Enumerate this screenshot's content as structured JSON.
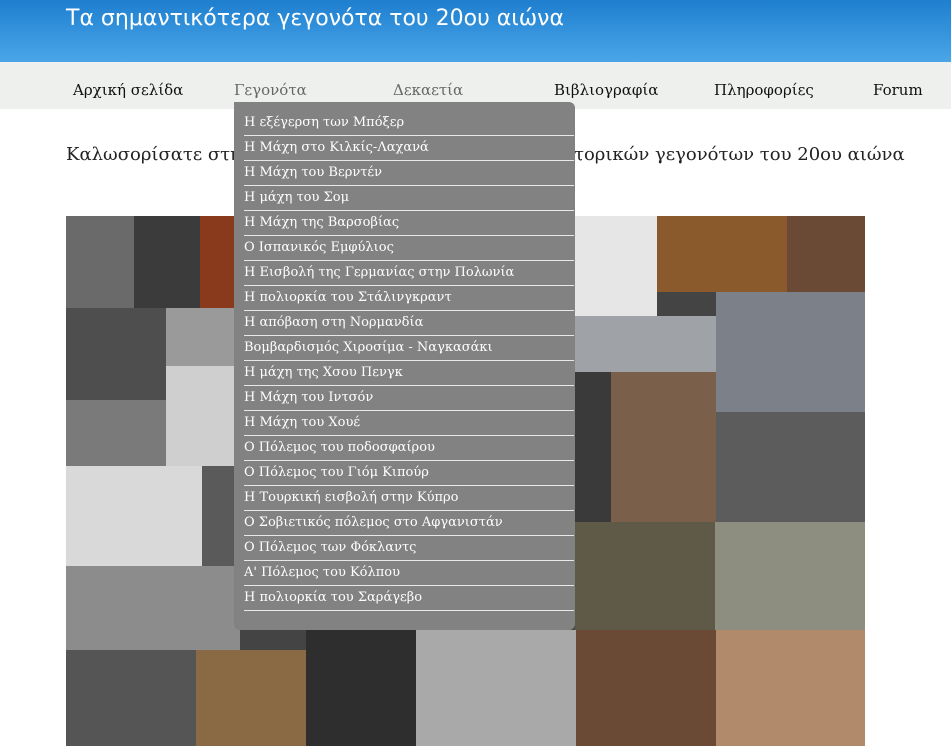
{
  "header": {
    "title": "Τα σημαντικότερα γεγονότα του 20ου αιώνα"
  },
  "nav": {
    "home": "Αρχική σελίδα",
    "events": "Γεγονότα",
    "decades": "Δεκαετία",
    "bibliography": "Βιβλιογραφία",
    "info": "Πληροφορίες",
    "forum": "Forum"
  },
  "welcome_left": "Καλωσορίσατε στη",
  "welcome_right": "τορικών γεγονότων του 20ου αιώνα",
  "dropdown": {
    "items": [
      "Η εξέγερση των Μπόξερ",
      "Η Μάχη στο Κιλκίς-Λαχανά",
      "Η Μάχη του Βερντέν",
      "Η μάχη του Σομ",
      "Η Μάχη της Βαρσοβίας",
      "Ο Ισπανικός Εμφύλιος",
      "Η Εισβολή της Γερμανίας στην Πολωνία",
      "Η πολιορκία του Στάλινγκραντ",
      "Η απόβαση στη Νορμανδία",
      "Βομβαρδισμός Χιροσίμα - Ναγκασάκι",
      "Η μάχη της Χσου Πενγκ",
      "Η Μάχη του Ιντσόν",
      "Η Μάχη του Χουέ",
      "Ο Πόλεμος του ποδοσφαίρου",
      "Ο Πόλεμος του Γιόμ Κιπούρ",
      "Η Τουρκική εισβολή στην Κύπρο",
      "Ο Σοβιετικός πόλεμος στο Αφγανιστάν",
      "Ο Πόλεμος των Φόκλαντς",
      "Α' Πόλεμος του Κόλπου",
      "Η πολιορκία του Σαράγεβο"
    ]
  },
  "colors": {
    "header_top": "#1e7fcf",
    "header_bottom": "#4aa6e8",
    "dropdown_bg": "#828282",
    "nav_bg": "#eef0ee"
  }
}
